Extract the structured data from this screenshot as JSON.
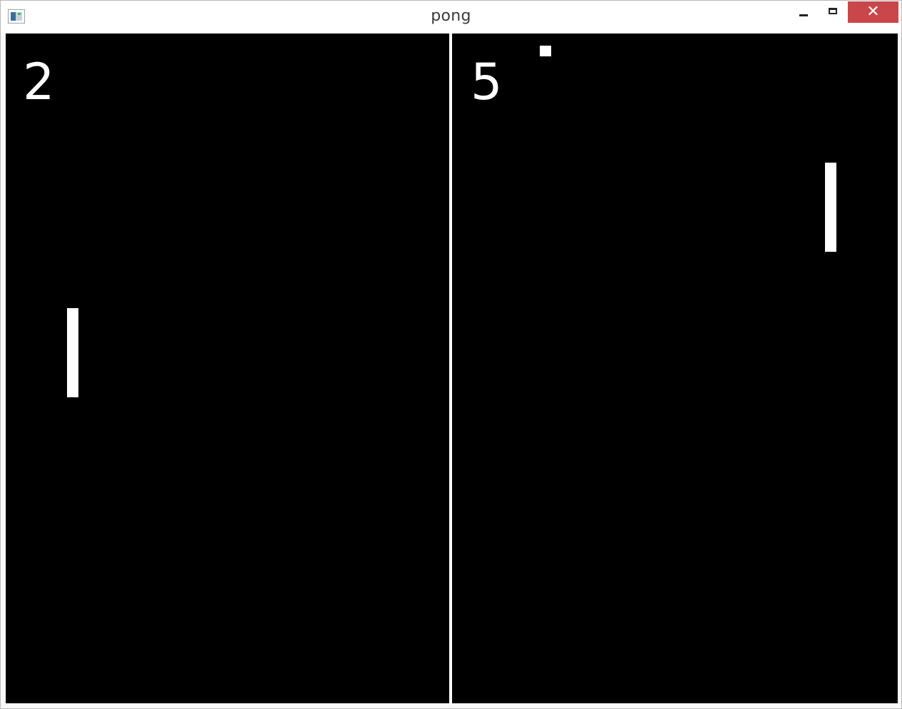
{
  "window": {
    "title": "pong",
    "app_icon": "app-window-icon",
    "controls": {
      "minimize_icon": "minimize-icon",
      "maximize_icon": "maximize-icon",
      "close_icon": "close-icon",
      "close_glyph": "✕",
      "close_color": "#c9474a"
    }
  },
  "game": {
    "background_color": "#000000",
    "foreground_color": "#ffffff",
    "scores": {
      "left": "2",
      "right": "5"
    }
  }
}
